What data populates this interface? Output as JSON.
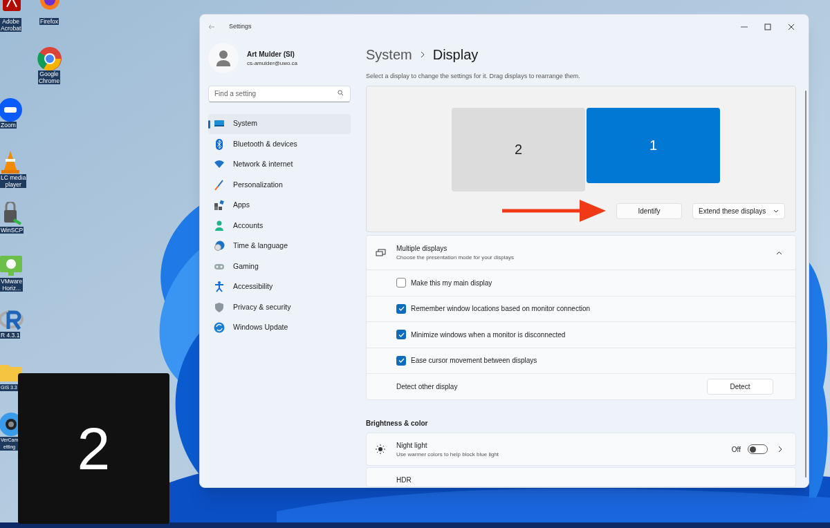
{
  "desktop_icons": [
    {
      "lines": [
        "Adobe",
        "Acrobat"
      ]
    },
    {
      "lines": [
        "Firefox"
      ]
    },
    {
      "lines": [
        "Google",
        "Chrome"
      ]
    },
    {
      "lines": [
        "Zoom"
      ]
    },
    {
      "lines": [
        "LC media",
        "player"
      ]
    },
    {
      "lines": [
        "WinSCP"
      ]
    },
    {
      "lines": [
        "VMware",
        "Horiz..."
      ]
    },
    {
      "lines": [
        "R 4.3.1"
      ]
    },
    {
      "lines": [
        "GIS 3.3"
      ]
    },
    {
      "lines": [
        "VerCam",
        "etting"
      ]
    }
  ],
  "identify_overlay": {
    "label": "2"
  },
  "window": {
    "title": "Settings"
  },
  "profile": {
    "name": "Art Mulder (SI)",
    "email": "cs-amulder@uwo.ca"
  },
  "search": {
    "placeholder": "Find a setting"
  },
  "nav": [
    {
      "label": "System",
      "selected": true
    },
    {
      "label": "Bluetooth & devices",
      "selected": false
    },
    {
      "label": "Network & internet",
      "selected": false
    },
    {
      "label": "Personalization",
      "selected": false
    },
    {
      "label": "Apps",
      "selected": false
    },
    {
      "label": "Accounts",
      "selected": false
    },
    {
      "label": "Time & language",
      "selected": false
    },
    {
      "label": "Gaming",
      "selected": false
    },
    {
      "label": "Accessibility",
      "selected": false
    },
    {
      "label": "Privacy & security",
      "selected": false
    },
    {
      "label": "Windows Update",
      "selected": false
    }
  ],
  "breadcrumb": [
    "System",
    "Display"
  ],
  "description": "Select a display to change the settings for it. Drag displays to rearrange them.",
  "displays": [
    {
      "label": "2",
      "selected": false
    },
    {
      "label": "1",
      "selected": true
    }
  ],
  "identify_button": "Identify",
  "arrangement_dropdown": "Extend these displays",
  "multiple_displays": {
    "title": "Multiple displays",
    "subtitle": "Choose the presentation mode for your displays",
    "expanded": true,
    "options": [
      {
        "label": "Make this my main display",
        "checked": false
      },
      {
        "label": "Remember window locations based on monitor connection",
        "checked": true
      },
      {
        "label": "Minimize windows when a monitor is disconnected",
        "checked": true
      },
      {
        "label": "Ease cursor movement between displays",
        "checked": true
      }
    ],
    "detect": {
      "label": "Detect other display",
      "button": "Detect"
    }
  },
  "brightness_heading": "Brightness & color",
  "night_light": {
    "title": "Night light",
    "subtitle": "Use warmer colors to help block blue light",
    "state_text": "Off",
    "on": false
  },
  "hdr": {
    "title": "HDR"
  }
}
